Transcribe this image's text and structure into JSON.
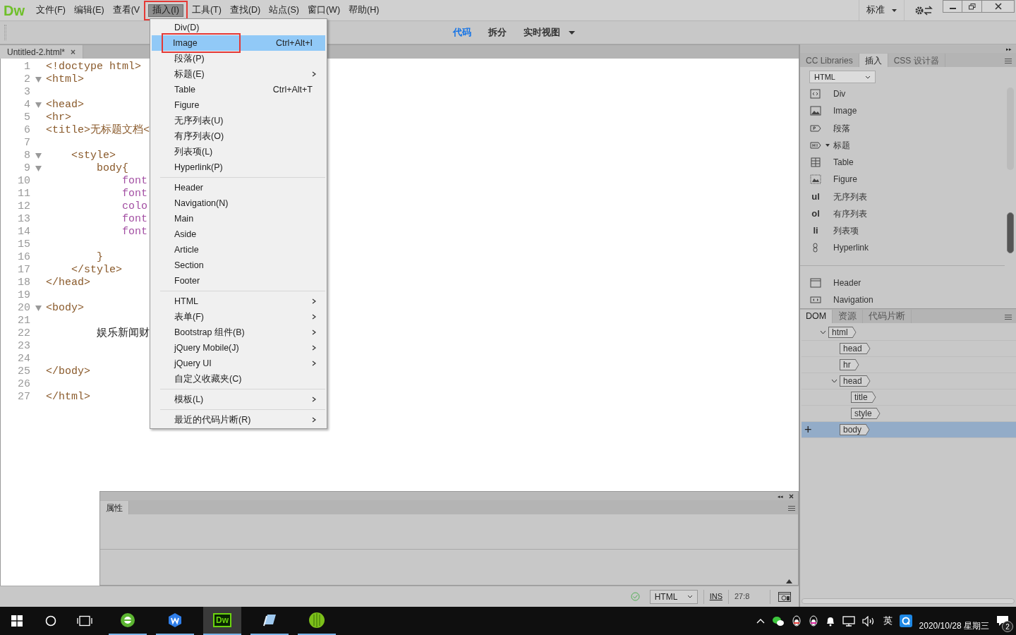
{
  "app_logo": "Dw",
  "menubar": [
    {
      "label": "文件(F)",
      "open": false
    },
    {
      "label": "编辑(E)",
      "open": false
    },
    {
      "label": "查看(V",
      "open": false
    },
    {
      "label": "插入(I)",
      "open": true
    },
    {
      "label": "工具(T)",
      "open": false
    },
    {
      "label": "查找(D)",
      "open": false
    },
    {
      "label": "站点(S)",
      "open": false
    },
    {
      "label": "窗口(W)",
      "open": false
    },
    {
      "label": "帮助(H)",
      "open": false
    }
  ],
  "workspace": {
    "label": "标准"
  },
  "view_tabs": [
    {
      "label": "代码",
      "selected": true,
      "dropdown": false
    },
    {
      "label": "拆分",
      "selected": false,
      "dropdown": false
    },
    {
      "label": "实时视图",
      "selected": false,
      "dropdown": true
    }
  ],
  "document_tab": {
    "title": "Untitled-2.html*",
    "close": "×"
  },
  "code_lines": [
    {
      "n": "1",
      "fold": false,
      "kind": "tag",
      "text": "<!doctype html>"
    },
    {
      "n": "2",
      "fold": true,
      "kind": "tag",
      "text": "<html>"
    },
    {
      "n": "3",
      "fold": false
    },
    {
      "n": "4",
      "fold": true,
      "kind": "tag",
      "text": "<head>"
    },
    {
      "n": "5",
      "fold": false,
      "kind": "tag",
      "text": "<hr>"
    },
    {
      "n": "6",
      "fold": false,
      "kind": "tag",
      "text": "<title>无标题文档<"
    },
    {
      "n": "7",
      "fold": false
    },
    {
      "n": "8",
      "fold": true,
      "kind": "tag",
      "text": "    <style>"
    },
    {
      "n": "9",
      "fold": true,
      "kind": "tag",
      "text": "        body{"
    },
    {
      "n": "10",
      "fold": false,
      "kind": "property",
      "text": "            font"
    },
    {
      "n": "11",
      "fold": false,
      "kind": "property",
      "text": "            font"
    },
    {
      "n": "12",
      "fold": false,
      "kind": "property",
      "text": "            colo"
    },
    {
      "n": "13",
      "fold": false,
      "kind": "property",
      "text": "            font"
    },
    {
      "n": "14",
      "fold": false,
      "kind": "property",
      "text": "            font"
    },
    {
      "n": "15",
      "fold": false
    },
    {
      "n": "16",
      "fold": false,
      "kind": "tag",
      "text": "        }"
    },
    {
      "n": "17",
      "fold": false,
      "kind": "tag",
      "text": "    </style>"
    },
    {
      "n": "18",
      "fold": false,
      "kind": "tag",
      "text": "</head>"
    },
    {
      "n": "19",
      "fold": false
    },
    {
      "n": "20",
      "fold": true,
      "kind": "tag",
      "text": "<body>"
    },
    {
      "n": "21",
      "fold": false
    },
    {
      "n": "22",
      "fold": false,
      "kind": "text",
      "text": "        娱乐新闻财"
    },
    {
      "n": "23",
      "fold": false
    },
    {
      "n": "24",
      "fold": false
    },
    {
      "n": "25",
      "fold": false,
      "kind": "tag",
      "text": "</body>"
    },
    {
      "n": "26",
      "fold": false
    },
    {
      "n": "27",
      "fold": false,
      "kind": "tag",
      "text": "</html>"
    }
  ],
  "insert_menu": [
    {
      "kind": "item",
      "label": "Div(D)",
      "submenu": false,
      "selected": false,
      "marked": false
    },
    {
      "kind": "item",
      "label": "Image",
      "shortcut": "Ctrl+Alt+I",
      "submenu": false,
      "selected": true,
      "marked": true
    },
    {
      "kind": "item",
      "label": "段落(P)",
      "submenu": false,
      "selected": false,
      "marked": false
    },
    {
      "kind": "item",
      "label": "标题(E)",
      "submenu": true,
      "selected": false,
      "marked": false
    },
    {
      "kind": "item",
      "label": "Table",
      "shortcut": "Ctrl+Alt+T",
      "submenu": false,
      "selected": false,
      "marked": false
    },
    {
      "kind": "item",
      "label": "Figure",
      "submenu": false,
      "selected": false,
      "marked": false
    },
    {
      "kind": "item",
      "label": "无序列表(U)",
      "submenu": false,
      "selected": false,
      "marked": false
    },
    {
      "kind": "item",
      "label": "有序列表(O)",
      "submenu": false,
      "selected": false,
      "marked": false
    },
    {
      "kind": "item",
      "label": "列表项(L)",
      "submenu": false,
      "selected": false,
      "marked": false
    },
    {
      "kind": "item",
      "label": "Hyperlink(P)",
      "submenu": false,
      "selected": false,
      "marked": false
    },
    {
      "kind": "separator"
    },
    {
      "kind": "item",
      "label": "Header",
      "submenu": false,
      "selected": false,
      "marked": false
    },
    {
      "kind": "item",
      "label": "Navigation(N)",
      "submenu": false,
      "selected": false,
      "marked": false
    },
    {
      "kind": "item",
      "label": "Main",
      "submenu": false,
      "selected": false,
      "marked": false
    },
    {
      "kind": "item",
      "label": "Aside",
      "submenu": false,
      "selected": false,
      "marked": false
    },
    {
      "kind": "item",
      "label": "Article",
      "submenu": false,
      "selected": false,
      "marked": false
    },
    {
      "kind": "item",
      "label": "Section",
      "submenu": false,
      "selected": false,
      "marked": false
    },
    {
      "kind": "item",
      "label": "Footer",
      "submenu": false,
      "selected": false,
      "marked": false
    },
    {
      "kind": "separator"
    },
    {
      "kind": "item",
      "label": "HTML",
      "submenu": true,
      "selected": false,
      "marked": false
    },
    {
      "kind": "item",
      "label": "表单(F)",
      "submenu": true,
      "selected": false,
      "marked": false
    },
    {
      "kind": "item",
      "label": "Bootstrap 组件(B)",
      "submenu": true,
      "selected": false,
      "marked": false
    },
    {
      "kind": "item",
      "label": "jQuery Mobile(J)",
      "submenu": true,
      "selected": false,
      "marked": false
    },
    {
      "kind": "item",
      "label": "jQuery UI",
      "submenu": true,
      "selected": false,
      "marked": false
    },
    {
      "kind": "item",
      "label": "自定义收藏夹(C)",
      "submenu": false,
      "selected": false,
      "marked": false
    },
    {
      "kind": "separator"
    },
    {
      "kind": "item",
      "label": "模板(L)",
      "submenu": true,
      "selected": false,
      "marked": false
    },
    {
      "kind": "separator"
    },
    {
      "kind": "item",
      "label": "最近的代码片断(R)",
      "submenu": true,
      "selected": false,
      "marked": false
    }
  ],
  "properties_panel": {
    "tab": "属性",
    "collapse": "◂◂"
  },
  "panel_dock": {
    "expand": "▸▸"
  },
  "status_bar": {
    "valid": true,
    "doc_type": "HTML",
    "mode": "INS",
    "position": "27:8"
  },
  "insert_panel": {
    "tabs": [
      {
        "label": "CC Libraries",
        "selected": false
      },
      {
        "label": "插入",
        "selected": true
      },
      {
        "label": "CSS 设计器",
        "selected": false
      }
    ],
    "category": "HTML",
    "items": [
      {
        "kind": "div",
        "label": "Div",
        "has_menu": false
      },
      {
        "kind": "image",
        "label": "Image",
        "has_menu": false
      },
      {
        "kind": "paragraph",
        "label": "段落",
        "has_menu": false
      },
      {
        "kind": "heading",
        "label": "标题",
        "has_menu": true
      },
      {
        "kind": "table",
        "label": "Table",
        "has_menu": false
      },
      {
        "kind": "figure",
        "label": "Figure",
        "has_menu": false
      },
      {
        "kind": "list",
        "glyph": "ul",
        "label": "无序列表",
        "has_menu": false
      },
      {
        "kind": "list",
        "glyph": "ol",
        "label": "有序列表",
        "has_menu": false
      },
      {
        "kind": "list",
        "glyph": "li",
        "label": "列表项",
        "has_menu": false
      },
      {
        "kind": "link",
        "label": "Hyperlink",
        "has_menu": false
      },
      {
        "kind": "separator"
      },
      {
        "kind": "header",
        "label": "Header",
        "has_menu": false
      },
      {
        "kind": "nav",
        "label": "Navigation",
        "has_menu": false
      }
    ]
  },
  "dom_panel": {
    "tabs": [
      {
        "label": "DOM",
        "selected": true
      },
      {
        "label": "资源",
        "selected": false
      },
      {
        "label": "代码片断",
        "selected": false
      }
    ],
    "tree": [
      {
        "tag": "html",
        "expanded": true,
        "selected": false,
        "children": [
          {
            "tag": "head",
            "selected": false
          },
          {
            "tag": "hr",
            "selected": false
          },
          {
            "tag": "head",
            "expanded": true,
            "selected": false,
            "children": [
              {
                "tag": "title",
                "selected": false
              },
              {
                "tag": "style",
                "selected": false
              }
            ]
          },
          {
            "tag": "body",
            "selected": true,
            "add_button": "+"
          }
        ]
      }
    ]
  },
  "taskbar": {
    "apps": [
      {
        "kind": "browser",
        "active": false
      },
      {
        "kind": "wps",
        "active": false
      },
      {
        "kind": "dw",
        "label": "Dw",
        "active": true
      },
      {
        "kind": "notepad",
        "active": false
      },
      {
        "kind": "green",
        "active": false
      }
    ],
    "ime": "英",
    "date": "2020/10/28 星期三",
    "notifications": "2"
  }
}
